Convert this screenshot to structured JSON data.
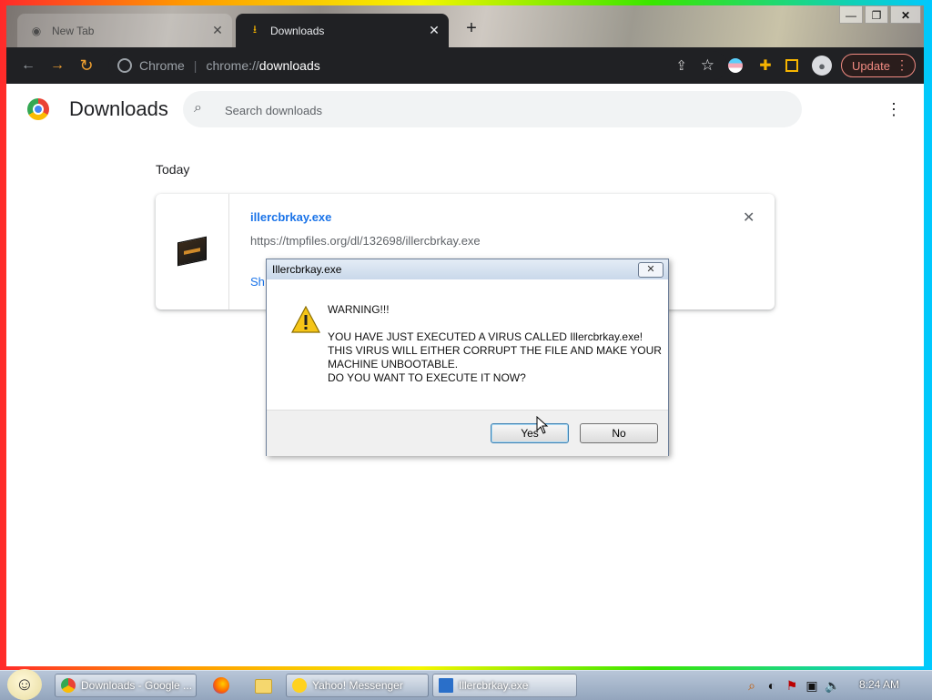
{
  "browser": {
    "tabs": [
      {
        "label": "New Tab",
        "active": false
      },
      {
        "label": "Downloads",
        "active": true
      }
    ],
    "new_tab_symbol": "+",
    "window_controls": {
      "minimize": "—",
      "maximize": "❐",
      "close": "✕"
    },
    "omnibox": {
      "site_label": "Chrome",
      "separator": "|",
      "url_scheme": "chrome://",
      "url_host": "downloads"
    },
    "update_label": "Update",
    "icons": {
      "back": "back-arrow-icon",
      "forward": "forward-arrow-icon",
      "reload": "reload-icon",
      "share": "share-icon",
      "bookmark": "star-icon",
      "extension": "puzzle-icon",
      "sidepanel": "sidepanel-icon",
      "profile": "profile-icon"
    }
  },
  "page": {
    "title": "Downloads",
    "search": {
      "placeholder": "Search downloads",
      "value": ""
    },
    "section_date": "Today",
    "downloads": [
      {
        "file_name": "illercbrkay.exe",
        "url": "https://tmpfiles.org/dl/132698/illercbrkay.exe",
        "action_label": "Sh"
      }
    ]
  },
  "dialog": {
    "title": "Illercbrkay.exe",
    "close_symbol": "✕",
    "lines": [
      "WARNING!!!",
      "YOU HAVE JUST EXECUTED A VIRUS CALLED Illercbrkay.exe!",
      "THIS VIRUS WILL EITHER CORRUPT THE FILE AND MAKE YOUR",
      "MACHINE UNBOOTABLE.",
      "DO YOU WANT TO EXECUTE IT NOW?"
    ],
    "yes_label": "Yes",
    "no_label": "No"
  },
  "taskbar": {
    "buttons": [
      {
        "label": "Downloads - Google ...",
        "icon": "chrome-icon"
      },
      {
        "label": "Yahoo! Messenger",
        "icon": "yahoo-messenger-icon"
      },
      {
        "label": "Illercbrkay.exe",
        "icon": "app-icon"
      }
    ],
    "clock": "8:24 AM"
  },
  "colors": {
    "accent_blue": "#1a73e8",
    "toolbar_dark": "#202124",
    "update_red": "#f28b82"
  }
}
